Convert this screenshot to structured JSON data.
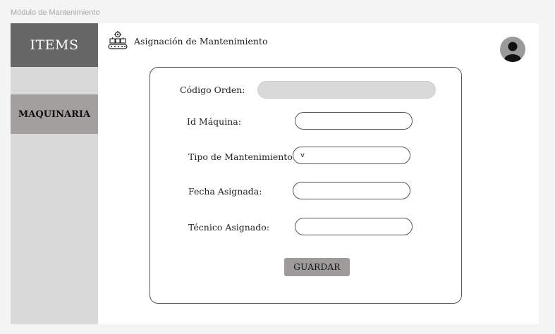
{
  "window": {
    "title": "Módulo de Mantenimiento"
  },
  "sidebar": {
    "items_label": "ITEMS",
    "menu": [
      {
        "label": "MAQUINARIA"
      }
    ]
  },
  "header": {
    "icon": "factory-gear-icon",
    "title": "Asignación de Mantenimiento",
    "avatar_icon": "user-avatar-icon"
  },
  "form": {
    "codigo_orden": {
      "label": "Código Orden:",
      "value": ""
    },
    "id_maquina": {
      "label": "Id Máquina:",
      "value": ""
    },
    "tipo_mantenimiento": {
      "label": "Tipo de Mantenimiento",
      "value": "v"
    },
    "fecha_asignada": {
      "label": "Fecha Asignada:",
      "value": ""
    },
    "tecnico_asignado": {
      "label": "Técnico Asignado:",
      "value": ""
    },
    "save_label": "GUARDAR"
  },
  "colors": {
    "sidebar_bg": "#d9d9d9",
    "items_bg": "#666666",
    "active_item_bg": "#a39f9f",
    "button_bg": "#9e9b9b"
  }
}
